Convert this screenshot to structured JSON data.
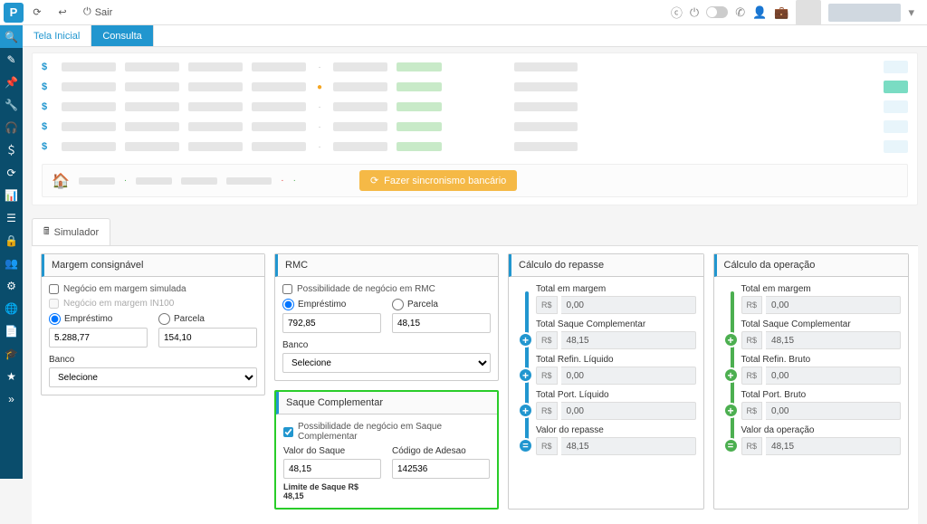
{
  "header": {
    "logo": "P",
    "sair_label": "Sair"
  },
  "tabs": {
    "home": "Tela Inicial",
    "consulta": "Consulta"
  },
  "summary": {
    "sync_btn": "Fazer sincronismo bancário"
  },
  "simulador": {
    "tab_label": "Simulador"
  },
  "margem": {
    "title": "Margem consignável",
    "chk_simulada": "Negócio em margem simulada",
    "chk_in100": "Negócio em margem IN100",
    "radio_emprestimo": "Empréstimo",
    "radio_parcela": "Parcela",
    "val_emprestimo": "5.288,77",
    "val_parcela": "154,10",
    "banco_label": "Banco",
    "banco_select": "Selecione"
  },
  "rmc": {
    "title": "RMC",
    "chk_rmc": "Possibilidade de negócio em RMC",
    "radio_emprestimo": "Empréstimo",
    "radio_parcela": "Parcela",
    "val_emprestimo": "792,85",
    "val_parcela": "48,15",
    "banco_label": "Banco",
    "banco_select": "Selecione"
  },
  "saque": {
    "title": "Saque Complementar",
    "chk_saque": "Possibilidade de negócio em Saque Complementar",
    "valor_label": "Valor do Saque",
    "valor": "48,15",
    "codigo_label": "Código de Adesao",
    "codigo": "142536",
    "limite": "Limite de Saque R$ 48,15"
  },
  "repasse": {
    "title": "Cálculo do repasse",
    "prefix": "R$",
    "r1_label": "Total em margem",
    "r1_val": "0,00",
    "r2_label": "Total Saque Complementar",
    "r2_val": "48,15",
    "r3_label": "Total Refin. Líquido",
    "r3_val": "0,00",
    "r4_label": "Total Port. Líquido",
    "r4_val": "0,00",
    "r5_label": "Valor do repasse",
    "r5_val": "48,15"
  },
  "operacao": {
    "title": "Cálculo da operação",
    "prefix": "R$",
    "r1_label": "Total em margem",
    "r1_val": "0,00",
    "r2_label": "Total Saque Complementar",
    "r2_val": "48,15",
    "r3_label": "Total Refin. Bruto",
    "r3_val": "0,00",
    "r4_label": "Total Port. Bruto",
    "r4_val": "0,00",
    "r5_label": "Valor da operação",
    "r5_val": "48,15"
  }
}
